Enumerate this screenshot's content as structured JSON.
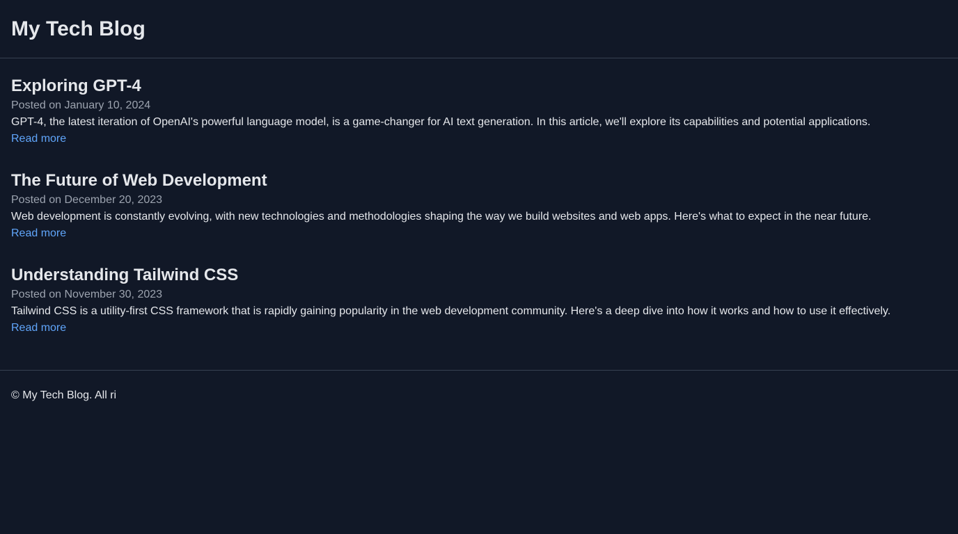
{
  "header": {
    "title": "My Tech Blog"
  },
  "posts": [
    {
      "title": "Exploring GPT-4",
      "date": "Posted on January 10, 2024",
      "excerpt": "GPT-4, the latest iteration of OpenAI's powerful language model, is a game-changer for AI text generation. In this article, we'll explore its capabilities and potential applications.",
      "read_more": "Read more"
    },
    {
      "title": "The Future of Web Development",
      "date": "Posted on December 20, 2023",
      "excerpt": "Web development is constantly evolving, with new technologies and methodologies shaping the way we build websites and web apps. Here's what to expect in the near future.",
      "read_more": "Read more"
    },
    {
      "title": "Understanding Tailwind CSS",
      "date": "Posted on November 30, 2023",
      "excerpt": "Tailwind CSS is a utility-first CSS framework that is rapidly gaining popularity in the web development community. Here's a deep dive into how it works and how to use it effectively.",
      "read_more": "Read more"
    }
  ],
  "footer": {
    "text": "© My Tech Blog. All ri"
  },
  "colors": {
    "background": "#111827",
    "text": "#e5e7eb",
    "muted": "#9ca3af",
    "link": "#60a5fa",
    "divider": "#374151"
  }
}
